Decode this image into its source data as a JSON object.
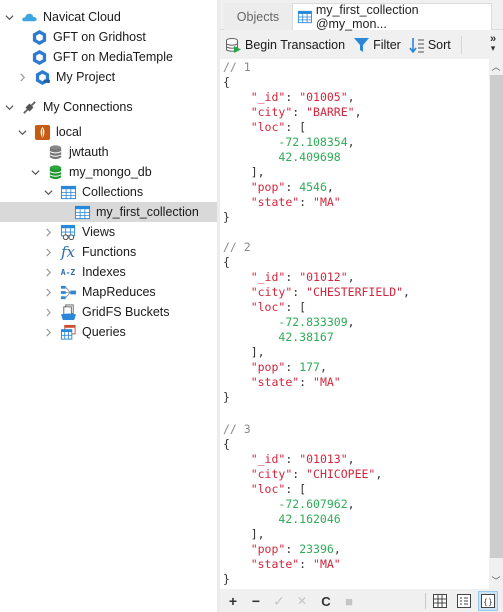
{
  "sidebar": {
    "items": [
      {
        "label": "Navicat Cloud",
        "icon": "cloud-icon",
        "expanded": true
      },
      {
        "label": "GFT on Gridhost",
        "icon": "project-hex-icon"
      },
      {
        "label": "GFT on MediaTemple",
        "icon": "project-hex-icon"
      },
      {
        "label": "My Project",
        "icon": "shared-project-icon",
        "expanded": false
      },
      {
        "label": "My Connections",
        "icon": "plug-icon",
        "expanded": true
      },
      {
        "label": "local",
        "icon": "mongodb-connection-icon",
        "expanded": true
      },
      {
        "label": "jwtauth",
        "icon": "database-gray-icon"
      },
      {
        "label": "my_mongo_db",
        "icon": "database-green-icon",
        "expanded": true
      },
      {
        "label": "Collections",
        "icon": "table-icon",
        "expanded": true
      },
      {
        "label": "my_first_collection",
        "icon": "table-icon",
        "selected": true
      },
      {
        "label": "Views",
        "icon": "view-icon",
        "expanded": false
      },
      {
        "label": "Functions",
        "icon": "function-icon",
        "expanded": false
      },
      {
        "label": "Indexes",
        "icon": "index-az-icon",
        "expanded": false
      },
      {
        "label": "MapReduces",
        "icon": "mapreduce-icon",
        "expanded": false
      },
      {
        "label": "GridFS Buckets",
        "icon": "gridfs-icon",
        "expanded": false
      },
      {
        "label": "Queries",
        "icon": "query-icon",
        "expanded": false
      }
    ]
  },
  "tabs": {
    "objects": "Objects",
    "collection": "my_first_collection @my_mon..."
  },
  "toolbar": {
    "begin_transaction": "Begin Transaction",
    "filter": "Filter",
    "sort": "Sort",
    "more": "»"
  },
  "documents": [
    {
      "comment": "// 1",
      "_id": "\"01005\"",
      "city": "\"BARRE\"",
      "loc": [
        "-72.108354",
        "42.409698"
      ],
      "pop": "4546",
      "state": "\"MA\""
    },
    {
      "comment": "// 2",
      "_id": "\"01012\"",
      "city": "\"CHESTERFIELD\"",
      "loc": [
        "-72.833309",
        "42.38167"
      ],
      "pop": "177",
      "state": "\"MA\""
    },
    {
      "comment": "// 3",
      "_id": "\"01013\"",
      "city": "\"CHICOPEE\"",
      "loc": [
        "-72.607962",
        "42.162046"
      ],
      "pop": "23396",
      "state": "\"MA\""
    }
  ],
  "keys": {
    "id": "\"_id\"",
    "city": "\"city\"",
    "loc": "\"loc\"",
    "pop": "\"pop\"",
    "state": "\"state\""
  },
  "bottombar": {
    "add": "+",
    "delete": "−",
    "apply": "✓",
    "discard": "✕",
    "refresh": "C",
    "stop": "■",
    "views": [
      "grid-view",
      "form-view",
      "json-view"
    ],
    "active_view": "json-view"
  },
  "colors": {
    "key": "#d0263c",
    "number": "#2eab56",
    "comment": "#8a8a8a",
    "selection": "#d9d9d9",
    "accent": "#2b88d8"
  }
}
